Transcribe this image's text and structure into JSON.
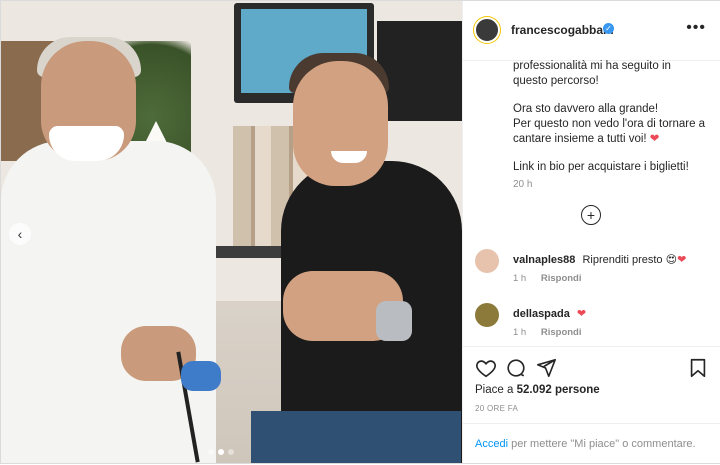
{
  "photo": {
    "alt_label": "",
    "carousel_prev_icon": "chevron-left-icon"
  },
  "header": {
    "username": "francescogabbani",
    "verified_icon": "verified-badge-icon",
    "more_icon": "more-options-icon"
  },
  "caption": {
    "lines_1": "professionalità mi ha seguito in questo percorso!",
    "lines_2a": "Ora sto davvero alla grande!",
    "lines_2b": "Per questo non vedo l'ora di tornare a cantare insieme a tutti voi!",
    "lines_3": "Link in bio per acquistare i biglietti!",
    "time": "20 h"
  },
  "load_more_icon": "plus-circle-icon",
  "comments": [
    {
      "user": "valnaples88",
      "text": "Riprenditi presto",
      "time": "1 h",
      "reply": "Rispondi"
    },
    {
      "user": "dellaspada",
      "text": "",
      "time": "1 h",
      "reply": "Rispondi"
    }
  ],
  "actions": {
    "like_icon": "heart-outline-icon",
    "comment_icon": "comment-bubble-icon",
    "share_icon": "paper-plane-icon",
    "save_icon": "bookmark-icon",
    "likes_prefix": "Piace a",
    "likes_count": "52.092",
    "likes_suffix": "persone",
    "age": "20 ORE FA"
  },
  "footer": {
    "login_link": "Accedi",
    "login_text": "per mettere \"Mi piace\" o commentare."
  },
  "colors": {
    "accent": "#0095f6",
    "heart": "#ed4956",
    "verified": "#3897f0"
  }
}
